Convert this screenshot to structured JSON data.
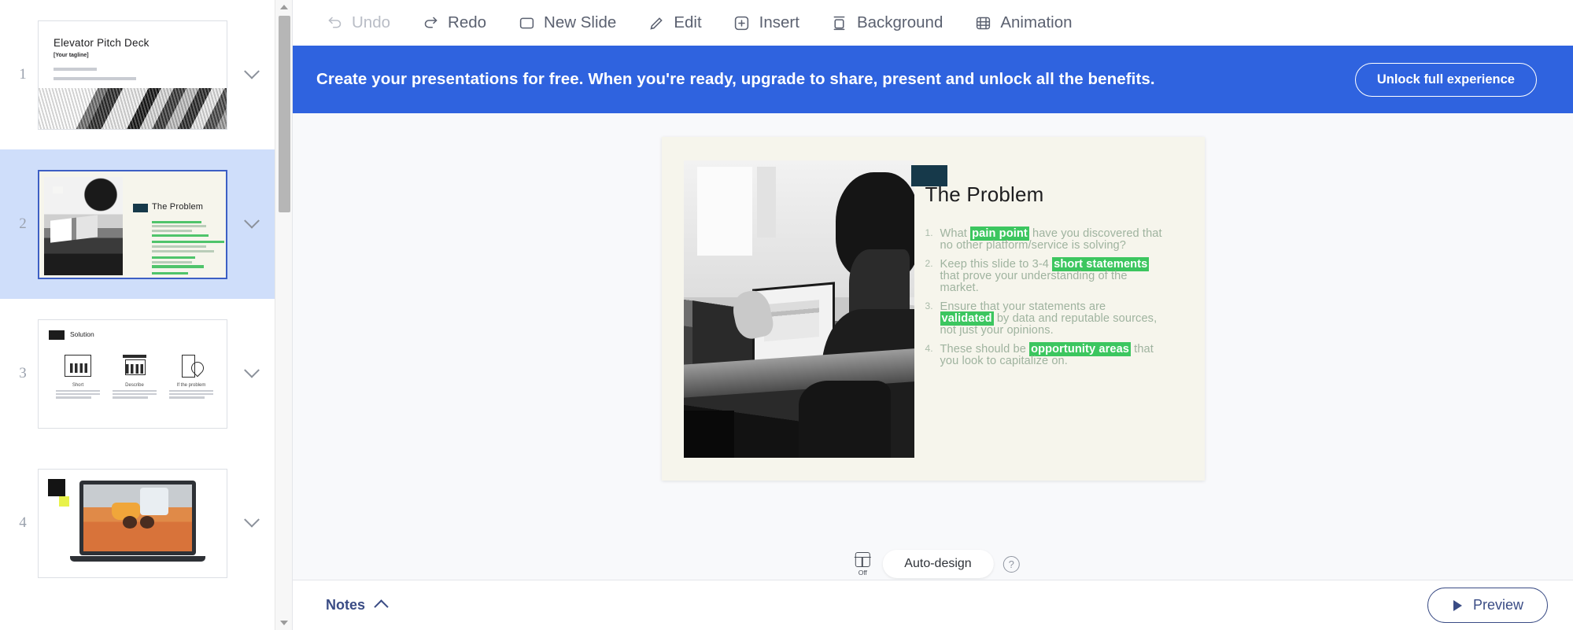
{
  "toolbar": {
    "items": [
      {
        "label": "Undo",
        "icon": "undo-icon",
        "disabled": true
      },
      {
        "label": "Redo",
        "icon": "redo-icon",
        "disabled": false
      },
      {
        "label": "New Slide",
        "icon": "new-slide-icon",
        "disabled": false
      },
      {
        "label": "Edit",
        "icon": "pencil-icon",
        "disabled": false
      },
      {
        "label": "Insert",
        "icon": "plus-square-icon",
        "disabled": false
      },
      {
        "label": "Background",
        "icon": "background-icon",
        "disabled": false
      },
      {
        "label": "Animation",
        "icon": "animation-icon",
        "disabled": false
      }
    ]
  },
  "banner": {
    "text": "Create your presentations for free. When you're ready, upgrade to share, present and unlock all the benefits.",
    "button_label": "Unlock full experience",
    "background_color": "#2f63df"
  },
  "sidebar": {
    "slides": [
      {
        "number": "1",
        "selected": false,
        "title": "Elevator Pitch Deck",
        "tagline": "[Your tagline]"
      },
      {
        "number": "2",
        "selected": true,
        "title": "The Problem"
      },
      {
        "number": "3",
        "selected": false,
        "title": "Solution",
        "columns": [
          {
            "heading": "Short"
          },
          {
            "heading": "Describe"
          },
          {
            "heading": "If the problem"
          }
        ]
      },
      {
        "number": "4",
        "selected": false,
        "title": ""
      }
    ]
  },
  "slide": {
    "title": "The Problem",
    "accent_color": "#16394a",
    "background_color": "#f6f5ec",
    "highlight_color": "#3cc65f",
    "bullets": [
      [
        {
          "t": "What ",
          "h": false
        },
        {
          "t": "pain point",
          "h": true
        },
        {
          "t": " have you discovered that no other platform/service is solving?",
          "h": false
        }
      ],
      [
        {
          "t": "Keep this slide to 3-4 ",
          "h": false
        },
        {
          "t": "short statements",
          "h": true
        },
        {
          "t": " that prove your understanding of the market.",
          "h": false
        }
      ],
      [
        {
          "t": "Ensure that your statements are ",
          "h": false
        },
        {
          "t": "validated",
          "h": true
        },
        {
          "t": " by data and reputable sources, not just your opinions.",
          "h": false
        }
      ],
      [
        {
          "t": "These should be ",
          "h": false
        },
        {
          "t": "opportunity areas",
          "h": true
        },
        {
          "t": " that you look to capitalize on.",
          "h": false
        }
      ]
    ]
  },
  "auto_design": {
    "toggle_state": "Off",
    "label": "Auto-design",
    "help_glyph": "?"
  },
  "bottom_bar": {
    "notes_label": "Notes",
    "preview_label": "Preview"
  }
}
